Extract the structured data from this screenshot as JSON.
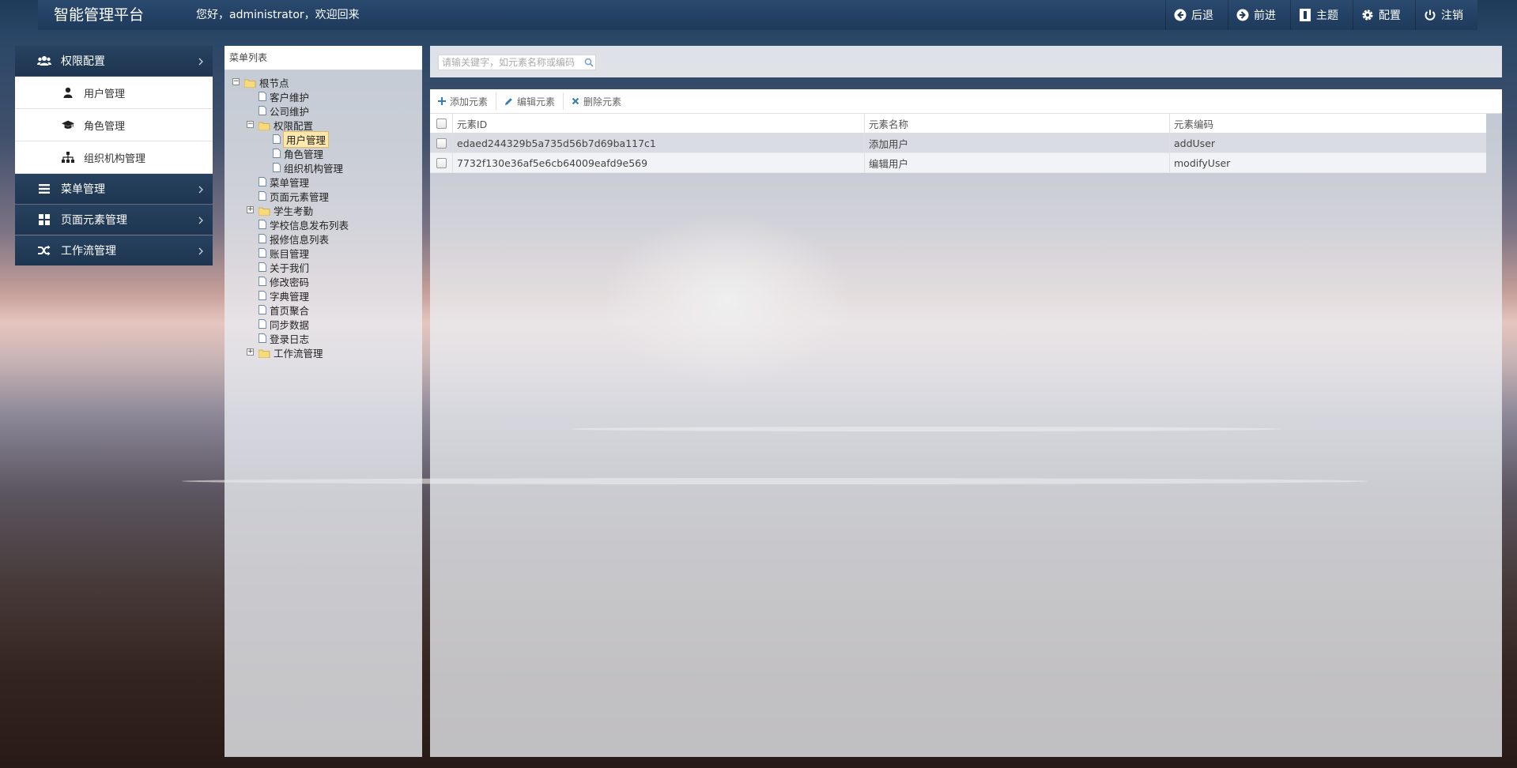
{
  "header": {
    "brand": "智能管理平台",
    "welcome": "您好，administrator，欢迎回来",
    "nav": [
      {
        "label": "后退",
        "icon": "arrow-left-circle-icon"
      },
      {
        "label": "前进",
        "icon": "arrow-right-circle-icon"
      },
      {
        "label": "主题",
        "icon": "theme-icon"
      },
      {
        "label": "配置",
        "icon": "gear-icon"
      },
      {
        "label": "注销",
        "icon": "power-icon"
      }
    ]
  },
  "sidebar": {
    "groups": [
      {
        "label": "权限配置",
        "icon": "users-icon",
        "expanded": true,
        "items": [
          {
            "label": "用户管理",
            "icon": "user-icon"
          },
          {
            "label": "角色管理",
            "icon": "graduation-cap-icon"
          },
          {
            "label": "组织机构管理",
            "icon": "sitemap-icon"
          }
        ]
      },
      {
        "label": "菜单管理",
        "icon": "list-icon"
      },
      {
        "label": "页面元素管理",
        "icon": "grid-icon"
      },
      {
        "label": "工作流管理",
        "icon": "shuffle-icon"
      }
    ]
  },
  "tree": {
    "title": "菜单列表",
    "root": "根节点",
    "nodes": {
      "n1": "客户维护",
      "n2": "公司维护",
      "n3": "权限配置",
      "n3a": "用户管理",
      "n3b": "角色管理",
      "n3c": "组织机构管理",
      "n4": "菜单管理",
      "n5": "页面元素管理",
      "n6": "学生考勤",
      "n7": "学校信息发布列表",
      "n8": "报修信息列表",
      "n9": "账目管理",
      "n10": "关于我们",
      "n11": "修改密码",
      "n12": "字典管理",
      "n13": "首页聚合",
      "n14": "同步数据",
      "n15": "登录日志",
      "n16": "工作流管理"
    }
  },
  "search": {
    "placeholder": "请输关键字，如元素名称或编码"
  },
  "toolbar": {
    "add": "添加元素",
    "edit": "编辑元素",
    "delete": "删除元素"
  },
  "grid": {
    "columns": {
      "id": "元素ID",
      "name": "元素名称",
      "code": "元素编码"
    },
    "rows": [
      {
        "id": "edaed244329b5a735d56b7d69ba117c1",
        "name": "添加用户",
        "code": "addUser"
      },
      {
        "id": "7732f130e36af5e6cb64009eafd9e569",
        "name": "编辑用户",
        "code": "modifyUser"
      }
    ]
  },
  "colors": {
    "header_bg": "#1e3a5c",
    "sidebar_bg": "#1d3550",
    "accent_blue": "#337ab7",
    "tree_selected": "#ffe8b0"
  }
}
